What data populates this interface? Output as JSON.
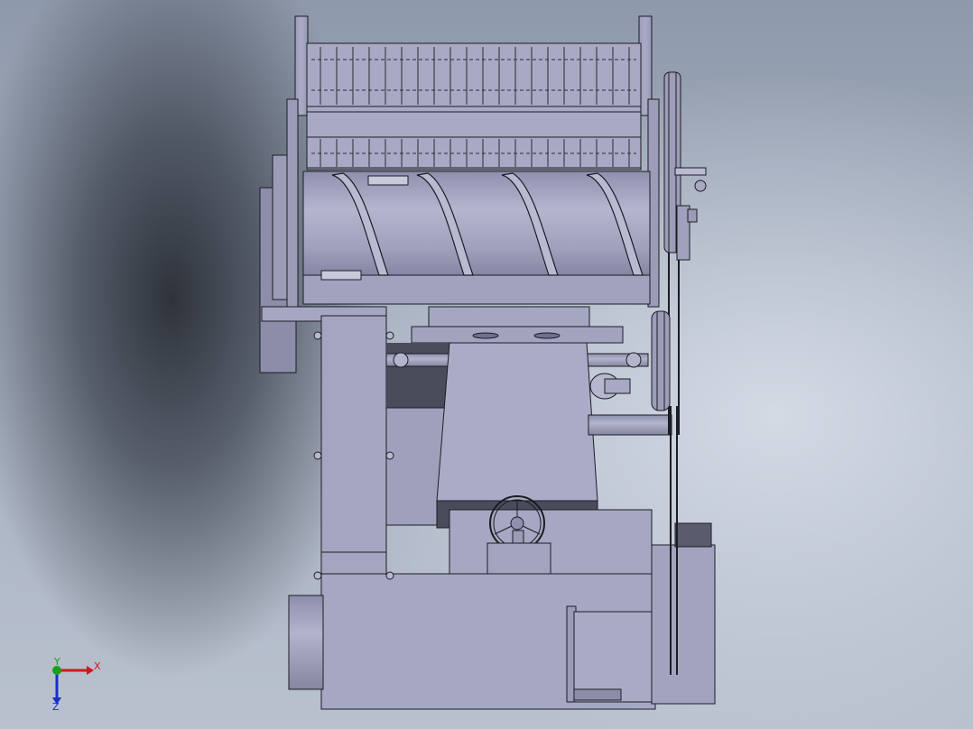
{
  "viewport": {
    "background": "gradient-gray-blue",
    "model_color": "#a3a5c1",
    "model_shadow": "#6e7090",
    "outline_color": "#1c1c24"
  },
  "triad": {
    "x_label": "X",
    "y_label": "Y",
    "z_label": "Z",
    "x_color": "#d01818",
    "y_color": "#18a018",
    "z_color": "#1830c8"
  }
}
